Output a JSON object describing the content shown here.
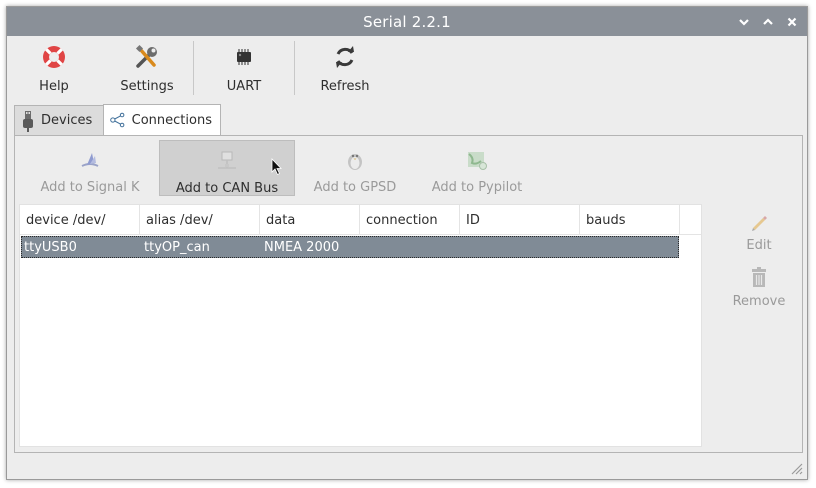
{
  "window": {
    "title": "Serial 2.2.1"
  },
  "titlebar": {
    "buttons": [
      {
        "name": "minimize-button",
        "icon": "chevron-down-icon"
      },
      {
        "name": "maximize-button",
        "icon": "chevron-up-icon"
      },
      {
        "name": "close-button",
        "icon": "close-icon"
      }
    ]
  },
  "toolbar": {
    "help_label": "Help",
    "settings_label": "Settings",
    "uart_label": "UART",
    "refresh_label": "Refresh"
  },
  "tabs": [
    {
      "label": "Devices",
      "icon": "usb-plug-icon",
      "active": false
    },
    {
      "label": "Connections",
      "icon": "share-icon",
      "active": true
    }
  ],
  "connections": {
    "actions": [
      {
        "label": "Add to Signal K",
        "icon": "signalk-icon",
        "enabled": false
      },
      {
        "label": "Add to CAN Bus",
        "icon": "network-icon",
        "enabled": true,
        "pressed": true
      },
      {
        "label": "Add to GPSD",
        "icon": "penguin-icon",
        "enabled": false
      },
      {
        "label": "Add to Pypilot",
        "icon": "map-icon",
        "enabled": false
      }
    ],
    "table": {
      "columns": [
        "device /dev/",
        "alias /dev/",
        "data",
        "connection",
        "ID",
        "bauds"
      ],
      "rows": [
        {
          "device": "ttyUSB0",
          "alias": "ttyOP_can",
          "data": "NMEA 2000",
          "connection": "",
          "id": "",
          "bauds": "",
          "selected": true
        }
      ]
    },
    "side_actions": {
      "edit_label": "Edit",
      "remove_label": "Remove"
    }
  },
  "colors": {
    "titlebar": "#8a9098",
    "selection": "#808b96",
    "help_red": "#e04545"
  }
}
